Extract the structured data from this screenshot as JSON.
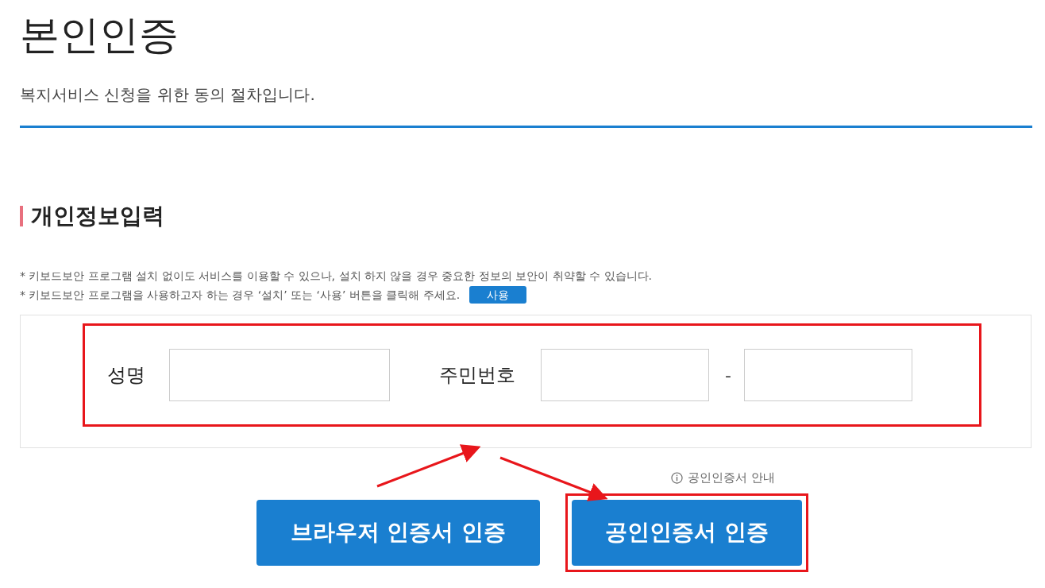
{
  "page": {
    "title": "본인인증",
    "subtitle": "복지서비스 신청을 위한 동의 절차입니다."
  },
  "section": {
    "heading": "개인정보입력"
  },
  "notes": [
    {
      "text": "* 키보드보안 프로그램 설치 없이도 서비스를 이용할 수 있으나, 설치 하지 않을 경우 중요한 정보의 보안이 취약할 수 있습니다."
    },
    {
      "text": "* 키보드보안 프로그램을 사용하고자 하는 경우 ‘설치’ 또는 ‘사용’ 버튼을 클릭해 주세요.",
      "button": "사용"
    }
  ],
  "form": {
    "highlighted": true,
    "name_label": "성명",
    "id_label": "주민번호",
    "separator": "-"
  },
  "info_link": "공인인증서 안내",
  "buttons": [
    {
      "label": "브라우저 인증서 인증",
      "highlighted": false
    },
    {
      "label": "공인인증서 인증",
      "highlighted": true
    }
  ],
  "annotation_arrows": true
}
